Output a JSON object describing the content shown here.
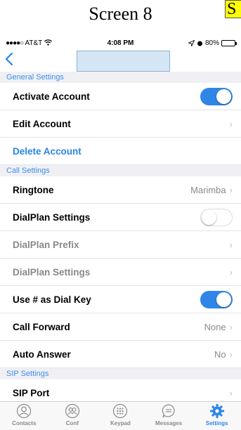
{
  "caption": {
    "text": "Screen 8",
    "corner_badge": "S"
  },
  "status_bar": {
    "signal": "●●●●○",
    "carrier": "AT&T",
    "time": "4:08 PM",
    "battery_percent": "80%",
    "battery_level": 0.8
  },
  "navbar": {
    "back_icon": "chevron-left-icon",
    "title": ""
  },
  "sections": [
    {
      "title": "General Settings",
      "rows": [
        {
          "label": "Activate Account",
          "kind": "toggle",
          "on": true
        },
        {
          "label": "Edit Account",
          "kind": "chevron",
          "value": ""
        },
        {
          "label": "Delete Account",
          "kind": "link"
        }
      ]
    },
    {
      "title": "Call Settings",
      "rows": [
        {
          "label": "Ringtone",
          "kind": "chevron",
          "value": "Marimba"
        },
        {
          "label": "DialPlan Settings",
          "kind": "toggle",
          "on": false
        },
        {
          "label": "DialPlan Prefix",
          "kind": "chevron",
          "value": "",
          "dim": true
        },
        {
          "label": "DialPlan Settings",
          "kind": "chevron",
          "value": "",
          "dim": true
        },
        {
          "label": "Use # as Dial Key",
          "kind": "toggle",
          "on": true
        },
        {
          "label": "Call Forward",
          "kind": "chevron",
          "value": "None"
        },
        {
          "label": "Auto Answer",
          "kind": "chevron",
          "value": "No"
        }
      ]
    },
    {
      "title": "SIP Settings",
      "rows": [
        {
          "label": "SIP Port",
          "kind": "chevron",
          "value": ""
        }
      ]
    }
  ],
  "tabs": [
    {
      "label": "Contacts",
      "icon": "person-icon",
      "active": false
    },
    {
      "label": "Conf",
      "icon": "group-icon",
      "active": false
    },
    {
      "label": "Keypad",
      "icon": "keypad-icon",
      "active": false
    },
    {
      "label": "Messages",
      "icon": "chat-bubble-icon",
      "active": false
    },
    {
      "label": "Settings",
      "icon": "gear-icon",
      "active": true
    }
  ],
  "colors": {
    "accent": "#2f86e6",
    "section_text": "#3d8eea",
    "section_bg": "#f0f0f4",
    "inactive_tab": "#8a8a8e"
  }
}
